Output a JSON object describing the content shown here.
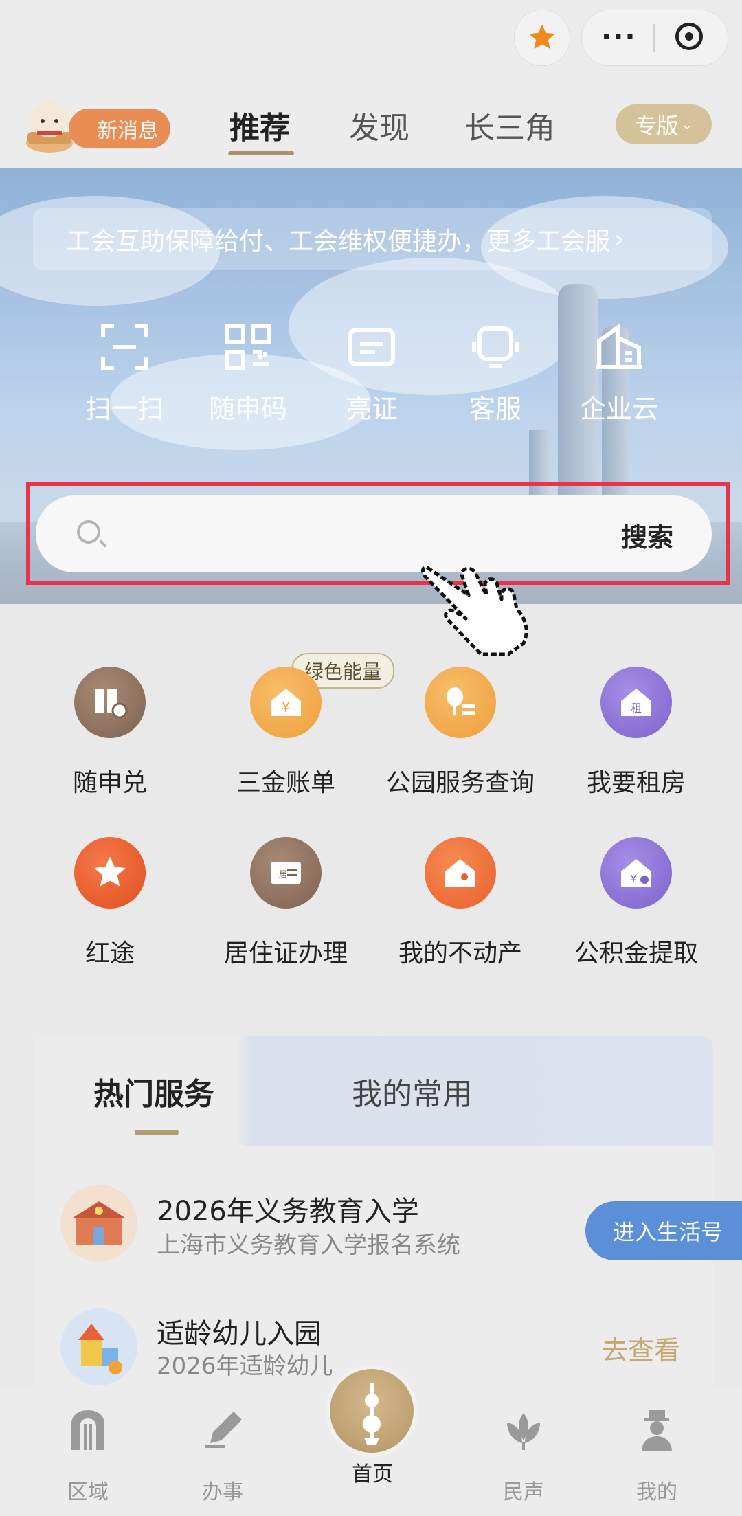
{
  "header": {
    "new_message": "新消息",
    "tabs": [
      {
        "label": "推荐",
        "active": true
      },
      {
        "label": "发现",
        "active": false
      },
      {
        "label": "长三角",
        "active": false
      }
    ],
    "edition": "专版"
  },
  "banner": {
    "notice": "工会互助保障给付、工会维权便捷办，更多工会服",
    "quick_actions": [
      {
        "label": "扫一扫",
        "icon": "scan-icon"
      },
      {
        "label": "随申码",
        "icon": "qrcode-icon"
      },
      {
        "label": "亮证",
        "icon": "license-icon"
      },
      {
        "label": "客服",
        "icon": "customer-service-icon"
      },
      {
        "label": "企业云",
        "icon": "enterprise-cloud-icon"
      }
    ]
  },
  "search": {
    "placeholder": "",
    "button": "搜索"
  },
  "services": {
    "tag": "绿色能量",
    "items": [
      {
        "label": "随申兑",
        "color": "#8f7360"
      },
      {
        "label": "三金账单",
        "color": "#f0a44a"
      },
      {
        "label": "公园服务查询",
        "color": "#f0a44a"
      },
      {
        "label": "我要租房",
        "color": "#8a72d6"
      },
      {
        "label": "红途",
        "color": "#e9582f"
      },
      {
        "label": "居住证办理",
        "color": "#8f7360"
      },
      {
        "label": "我的不动产",
        "color": "#ec6a37"
      },
      {
        "label": "公积金提取",
        "color": "#8a72d6"
      }
    ]
  },
  "card": {
    "tabs": [
      "热门服务",
      "我的常用"
    ],
    "rows": [
      {
        "title": "2026年义务教育入学",
        "subtitle": "上海市义务教育入学报名系统"
      },
      {
        "title": "适龄幼儿入园",
        "subtitle": "2026年适龄幼儿",
        "action": "去查看"
      }
    ],
    "enter_button": "进入生活号"
  },
  "bottom_nav": [
    {
      "label": "区域",
      "active": false
    },
    {
      "label": "办事",
      "active": false
    },
    {
      "label": "首页",
      "active": true
    },
    {
      "label": "民声",
      "active": false
    },
    {
      "label": "我的",
      "active": false
    }
  ]
}
